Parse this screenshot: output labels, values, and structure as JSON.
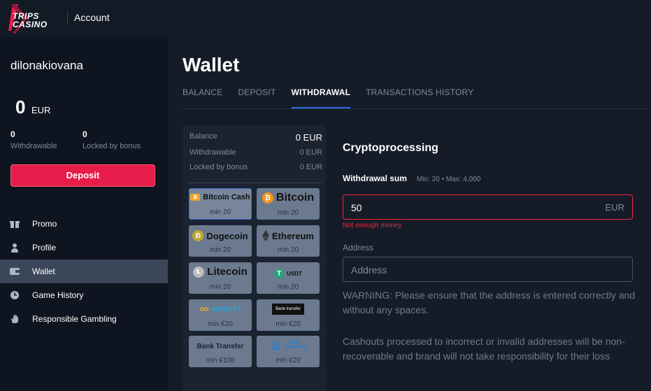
{
  "topbar": {
    "logo_line1": "TRIPS",
    "logo_line2": "CASINO",
    "account_label": "Account"
  },
  "sidebar": {
    "username": "dilonakiovana",
    "balance_amount": "0",
    "balance_currency": "EUR",
    "withdrawable_value": "0",
    "withdrawable_label": "Withdrawable",
    "locked_value": "0",
    "locked_label": "Locked by bonus",
    "deposit_button": "Deposit",
    "nav": [
      {
        "label": "Promo",
        "icon": "gift-icon"
      },
      {
        "label": "Profile",
        "icon": "user-icon"
      },
      {
        "label": "Wallet",
        "icon": "wallet-icon",
        "active": true
      },
      {
        "label": "Game History",
        "icon": "clock-icon"
      },
      {
        "label": "Responsible Gambling",
        "icon": "hand-icon"
      }
    ]
  },
  "main": {
    "title": "Wallet",
    "tabs": [
      "BALANCE",
      "DEPOSIT",
      "WITHDRAWAL",
      "TRANSACTIONS HISTORY"
    ],
    "active_tab": "WITHDRAWAL"
  },
  "balances": {
    "balance_label": "Balance",
    "balance_value": "0 EUR",
    "withdrawable_label": "Withdrawable",
    "withdrawable_value": "0 EUR",
    "locked_label": "Locked by bonus",
    "locked_value": "0 EUR"
  },
  "methods": [
    {
      "name": "Bitcoin Cash",
      "min": "min 20",
      "selected": true
    },
    {
      "name": "Bitcoin",
      "min": "min 20"
    },
    {
      "name": "Dogecoin",
      "min": "min 20"
    },
    {
      "name": "Ethereum",
      "min": "min 20"
    },
    {
      "name": "Litecoin",
      "min": "min 20"
    },
    {
      "name": "USDT",
      "min": "min 20"
    },
    {
      "name": "MIFINITY",
      "min": "min €20"
    },
    {
      "name": "Bank transfer",
      "min": "min €20"
    },
    {
      "name": "Bank Transfer",
      "min": "min €100"
    },
    {
      "name": "BANK TRANSFER",
      "min": "min €20"
    }
  ],
  "form": {
    "title": "Cryptoprocessing",
    "sum_label": "Withdrawal sum",
    "sum_limits": "Min: 20 • Max: 4,000",
    "sum_value": "50",
    "sum_currency": "EUR",
    "error": "Not enough money",
    "address_label": "Address",
    "address_placeholder": "Address",
    "warning1": "WARNING: Please ensure that the address is entered correctly and without any spaces.",
    "warning2": "Cashouts processed to incorrect or invalid addresses will be non-recoverable and brand will not take responsibility for their loss"
  },
  "colors": {
    "accent": "#e81c4a",
    "tab_underline": "#2a6ae0",
    "error": "#e82c3a",
    "active_nav": "#3b4659"
  }
}
